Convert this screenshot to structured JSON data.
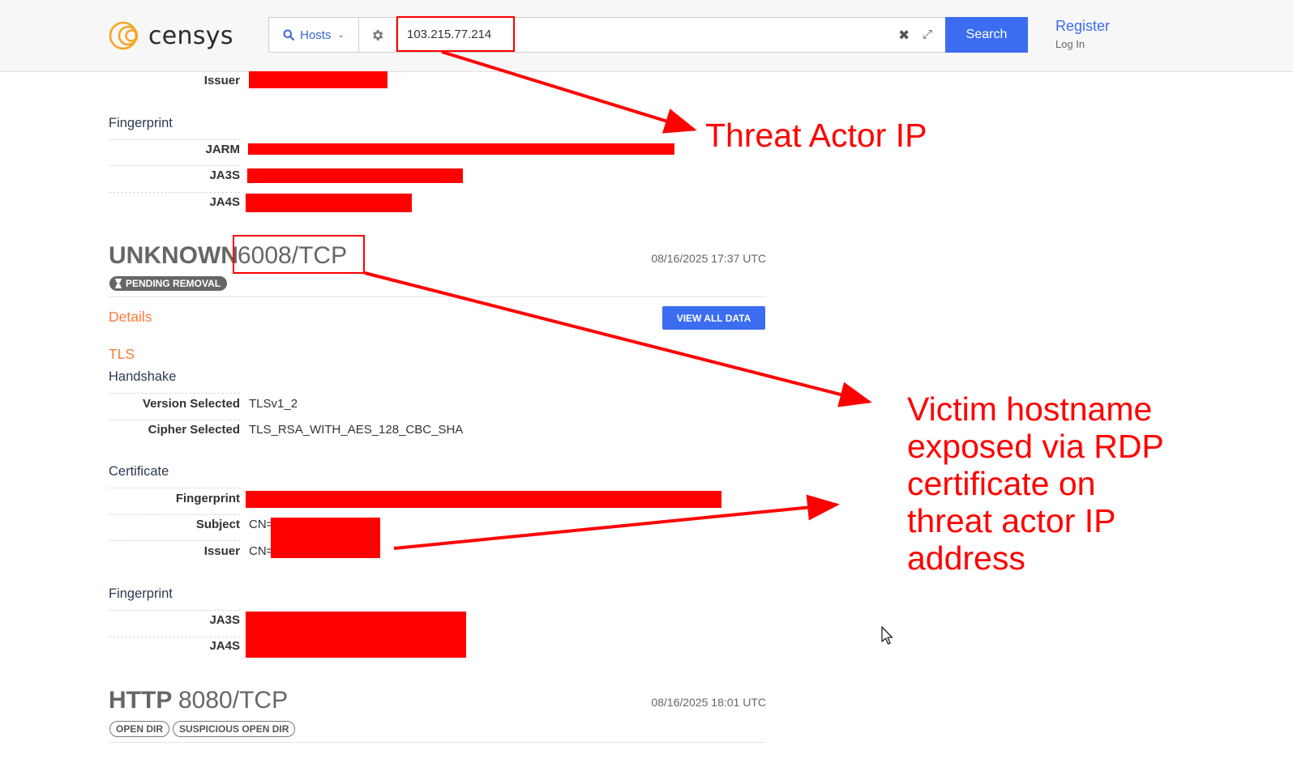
{
  "header": {
    "logo_text": "censys",
    "search_type": "Hosts",
    "query": "103.215.77.214",
    "search_button": "Search",
    "register": "Register",
    "login": "Log In"
  },
  "top_cert": {
    "issuer_label": "Issuer",
    "fingerprint_heading": "Fingerprint",
    "jarm_label": "JARM",
    "ja3s_label": "JA3S",
    "ja4s_label": "JA4S"
  },
  "service_6008": {
    "name": "UNKNOWN",
    "port": "6008/TCP",
    "timestamp": "08/16/2025 17:37 UTC",
    "badge": "PENDING REMOVAL",
    "details_heading": "Details",
    "view_all_button": "VIEW ALL DATA",
    "tls_heading": "TLS",
    "handshake_heading": "Handshake",
    "version_label": "Version Selected",
    "version_value": "TLSv1_2",
    "cipher_label": "Cipher Selected",
    "cipher_value": "TLS_RSA_WITH_AES_128_CBC_SHA",
    "certificate_heading": "Certificate",
    "cert_fingerprint_label": "Fingerprint",
    "subject_label": "Subject",
    "subject_prefix": "CN=",
    "issuer_label": "Issuer",
    "issuer_prefix": "CN=",
    "fingerprint_heading": "Fingerprint",
    "ja3s_label": "JA3S",
    "ja4s_label": "JA4S"
  },
  "service_8080": {
    "name": "HTTP",
    "port": "8080/TCP",
    "timestamp": "08/16/2025 18:01 UTC",
    "badges": [
      "OPEN DIR",
      "SUSPICIOUS OPEN DIR"
    ]
  },
  "annotations": {
    "threat_actor": "Threat Actor IP",
    "victim_lines": [
      "Victim hostname",
      "exposed via RDP",
      "certificate on",
      "threat actor IP",
      "address"
    ]
  },
  "colors": {
    "annotation_red": "#ff0000",
    "accent_blue": "#3c6df0",
    "section_orange": "#ff7a3a"
  }
}
